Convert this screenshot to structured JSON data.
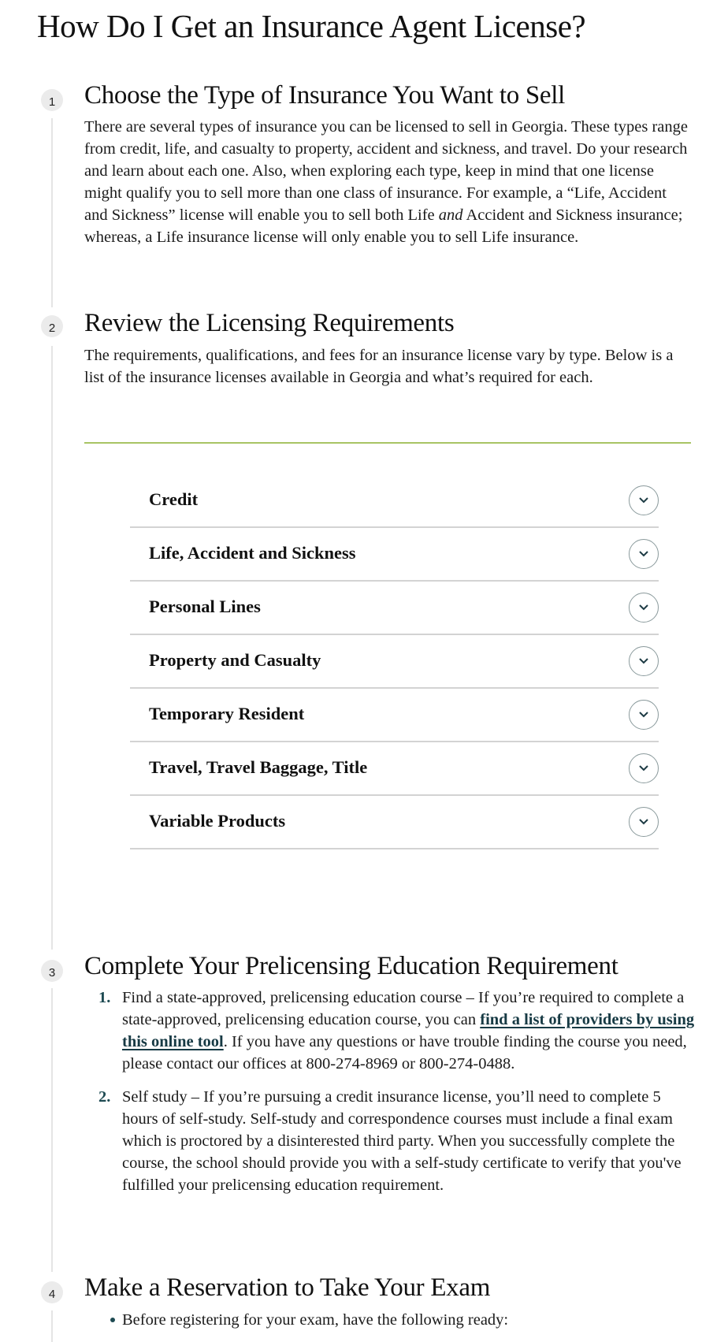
{
  "page": {
    "title": "How Do I Get an Insurance Agent License?"
  },
  "colors": {
    "accent_green": "#a8c464",
    "link": "#173a44",
    "list_marker": "#1d4a52",
    "step_badge_bg": "#ebebeb"
  },
  "steps": [
    {
      "number": "1",
      "title": "Choose the Type of Insurance You Want to Sell",
      "body_before_em": "There are several types of insurance you can be licensed to sell in Georgia. These types range from credit, life, and casualty to property, accident and sickness, and travel. Do your research and learn about each one. Also, when exploring each type, keep in mind that one license might qualify you to sell more than one class of insurance. For example, a “Life, Accident and Sickness” license will enable you to sell both Life ",
      "body_em": "and",
      "body_after_em": " Accident and Sickness insurance; whereas, a Life insurance license will only enable you to sell Life insurance."
    },
    {
      "number": "2",
      "title": "Review the Licensing Requirements",
      "body": "The requirements, qualifications, and fees for an insurance license vary by type. Below is a list of the insurance licenses available in Georgia and what’s required for each.",
      "accordion": [
        {
          "label": "Credit",
          "icon": "chevron-down-icon",
          "expanded": false
        },
        {
          "label": "Life, Accident and Sickness",
          "icon": "chevron-down-icon",
          "expanded": false
        },
        {
          "label": "Personal Lines",
          "icon": "chevron-down-icon",
          "expanded": false
        },
        {
          "label": "Property and Casualty",
          "icon": "chevron-down-icon",
          "expanded": false
        },
        {
          "label": "Temporary Resident",
          "icon": "chevron-down-icon",
          "expanded": false
        },
        {
          "label": "Travel, Travel Baggage, Title",
          "icon": "chevron-down-icon",
          "expanded": false
        },
        {
          "label": "Variable Products",
          "icon": "chevron-down-icon",
          "expanded": false
        }
      ]
    },
    {
      "number": "3",
      "title": "Complete Your Prelicensing Education Requirement",
      "items": [
        {
          "marker": "1.",
          "text_before_link": "Find a state-approved, prelicensing education course – If you’re required to complete a state-approved, prelicensing education course, you can ",
          "link_text": "find a list of providers by using this online tool",
          "text_after_link": ". If you have any questions or have trouble finding the course you need, please contact our offices at 800-274-8969 or 800-274-0488."
        },
        {
          "marker": "2.",
          "text": "Self study – If you’re pursuing a credit insurance license, you’ll need to complete 5 hours of self-study. Self-study and correspondence courses must include a final exam which is proctored by a disinterested third party. When you successfully complete the course, the school should provide you with a self-study certificate to verify that you've fulfilled your prelicensing education requirement."
        }
      ]
    },
    {
      "number": "4",
      "title": "Make a Reservation to Take Your Exam",
      "bullets": [
        "Before registering for your exam, have the following ready:"
      ]
    }
  ]
}
